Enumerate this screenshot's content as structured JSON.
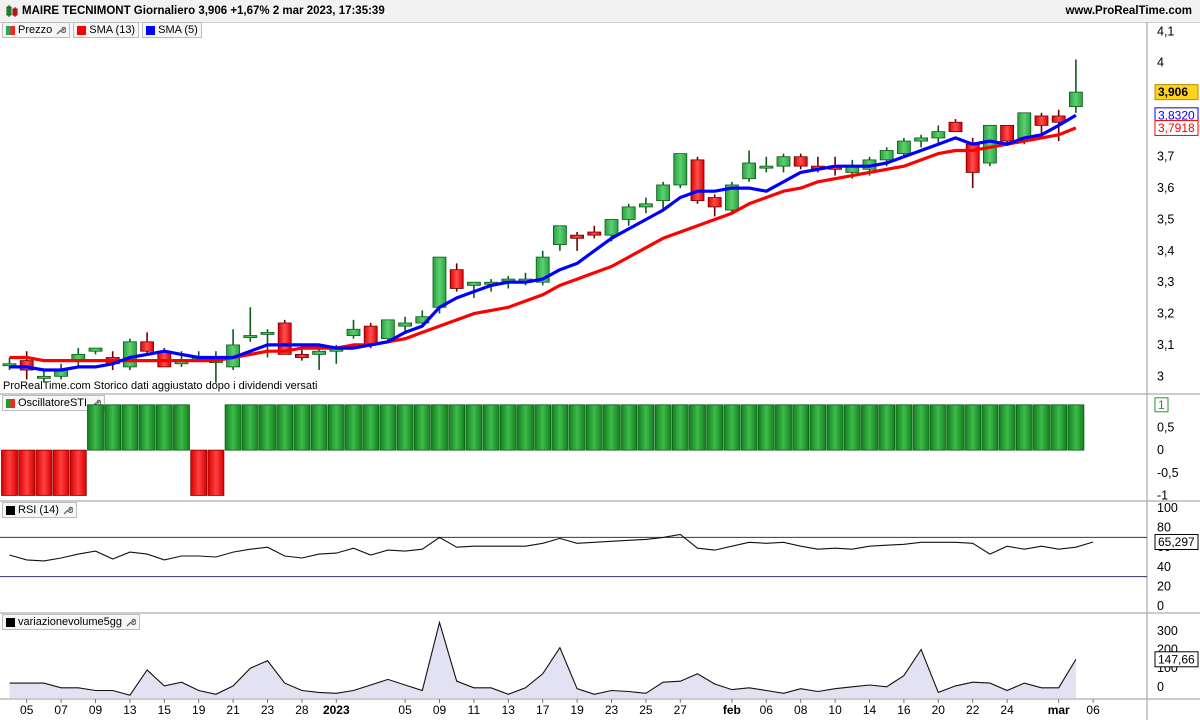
{
  "header": {
    "title": "MAIRE TECNIMONT Giornaliero 3,906 +1,67% 2 mar 2023, 17:35:39",
    "website": "www.ProRealTime.com"
  },
  "legends": {
    "price": [
      {
        "label": "Prezzo",
        "color": "#2e8b3c",
        "icon": "candle-icon"
      },
      {
        "label": "SMA (13)",
        "color": "#ff0000"
      },
      {
        "label": "SMA (5)",
        "color": "#0000ff"
      }
    ],
    "oscillator": "OscillatoreSTI",
    "rsi": "RSI (14)",
    "volume": "variazionevolume5gg"
  },
  "footnote": "ProRealTime.com  Storico dati aggiustato dopo i dividendi versati",
  "colors": {
    "up": "#2ea84a",
    "down": "#ff2020",
    "sma13": "#ff0000",
    "sma5": "#0000ff",
    "osc_pos": "#1f9a2b",
    "osc_neg": "#ff2020",
    "price_badge": "#ffd21f"
  },
  "price_labels": {
    "last": "3,906",
    "sma5": "3,8320",
    "sma13": "3,7918"
  },
  "rsi_label": "65,297",
  "volume_label": "147,66",
  "x_axis": [
    {
      "i": 1,
      "label": "05"
    },
    {
      "i": 3,
      "label": "07"
    },
    {
      "i": 5,
      "label": "09"
    },
    {
      "i": 7,
      "label": "13"
    },
    {
      "i": 9,
      "label": "15"
    },
    {
      "i": 11,
      "label": "19"
    },
    {
      "i": 13,
      "label": "21"
    },
    {
      "i": 15,
      "label": "23"
    },
    {
      "i": 17,
      "label": "28"
    },
    {
      "i": 19,
      "label": "2023",
      "bold": true
    },
    {
      "i": 23,
      "label": "05"
    },
    {
      "i": 25,
      "label": "09"
    },
    {
      "i": 27,
      "label": "11"
    },
    {
      "i": 29,
      "label": "13"
    },
    {
      "i": 31,
      "label": "17"
    },
    {
      "i": 33,
      "label": "19"
    },
    {
      "i": 35,
      "label": "23"
    },
    {
      "i": 37,
      "label": "25"
    },
    {
      "i": 39,
      "label": "27"
    },
    {
      "i": 42,
      "label": "feb",
      "bold": true
    },
    {
      "i": 44,
      "label": "06"
    },
    {
      "i": 46,
      "label": "08"
    },
    {
      "i": 48,
      "label": "10"
    },
    {
      "i": 50,
      "label": "14"
    },
    {
      "i": 52,
      "label": "16"
    },
    {
      "i": 54,
      "label": "20"
    },
    {
      "i": 56,
      "label": "22"
    },
    {
      "i": 58,
      "label": "24"
    },
    {
      "i": 61,
      "label": "mar",
      "bold": true
    },
    {
      "i": 63,
      "label": "06"
    }
  ],
  "chart_data": [
    {
      "type": "candlestick",
      "title": "MAIRE TECNIMONT Giornaliero",
      "ylim": [
        2.95,
        4.12
      ],
      "y_ticks": [
        "3",
        "3,1",
        "3,2",
        "3,3",
        "3,4",
        "3,5",
        "3,6",
        "3,7",
        "4",
        "4,1"
      ],
      "y_tick_values": [
        3.0,
        3.1,
        3.2,
        3.3,
        3.4,
        3.5,
        3.6,
        3.7,
        4.0,
        4.1
      ],
      "candles": [
        {
          "o": 3.04,
          "h": 3.06,
          "l": 3.02,
          "c": 3.04
        },
        {
          "o": 3.05,
          "h": 3.08,
          "l": 2.99,
          "c": 3.02
        },
        {
          "o": 3.0,
          "h": 3.02,
          "l": 2.98,
          "c": 3.0
        },
        {
          "o": 3.0,
          "h": 3.04,
          "l": 2.99,
          "c": 3.02
        },
        {
          "o": 3.05,
          "h": 3.09,
          "l": 3.03,
          "c": 3.07
        },
        {
          "o": 3.08,
          "h": 3.09,
          "l": 3.07,
          "c": 3.09
        },
        {
          "o": 3.06,
          "h": 3.08,
          "l": 3.02,
          "c": 3.04
        },
        {
          "o": 3.03,
          "h": 3.12,
          "l": 3.02,
          "c": 3.11
        },
        {
          "o": 3.11,
          "h": 3.14,
          "l": 3.07,
          "c": 3.08
        },
        {
          "o": 3.08,
          "h": 3.09,
          "l": 3.03,
          "c": 3.03
        },
        {
          "o": 3.04,
          "h": 3.08,
          "l": 3.03,
          "c": 3.05
        },
        {
          "o": 3.06,
          "h": 3.08,
          "l": 3.05,
          "c": 3.06
        },
        {
          "o": 3.05,
          "h": 3.08,
          "l": 2.98,
          "c": 3.05
        },
        {
          "o": 3.03,
          "h": 3.15,
          "l": 3.02,
          "c": 3.1
        },
        {
          "o": 3.13,
          "h": 3.22,
          "l": 3.11,
          "c": 3.13
        },
        {
          "o": 3.14,
          "h": 3.15,
          "l": 3.06,
          "c": 3.14
        },
        {
          "o": 3.17,
          "h": 3.18,
          "l": 3.07,
          "c": 3.07
        },
        {
          "o": 3.07,
          "h": 3.09,
          "l": 3.05,
          "c": 3.06
        },
        {
          "o": 3.07,
          "h": 3.09,
          "l": 3.02,
          "c": 3.08
        },
        {
          "o": 3.08,
          "h": 3.1,
          "l": 3.04,
          "c": 3.09
        },
        {
          "o": 3.13,
          "h": 3.18,
          "l": 3.12,
          "c": 3.15
        },
        {
          "o": 3.16,
          "h": 3.17,
          "l": 3.09,
          "c": 3.1
        },
        {
          "o": 3.12,
          "h": 3.18,
          "l": 3.11,
          "c": 3.18
        },
        {
          "o": 3.16,
          "h": 3.19,
          "l": 3.14,
          "c": 3.17
        },
        {
          "o": 3.17,
          "h": 3.21,
          "l": 3.16,
          "c": 3.19
        },
        {
          "o": 3.22,
          "h": 3.38,
          "l": 3.2,
          "c": 3.38
        },
        {
          "o": 3.34,
          "h": 3.36,
          "l": 3.27,
          "c": 3.28
        },
        {
          "o": 3.29,
          "h": 3.3,
          "l": 3.25,
          "c": 3.3
        },
        {
          "o": 3.3,
          "h": 3.31,
          "l": 3.27,
          "c": 3.3
        },
        {
          "o": 3.31,
          "h": 3.32,
          "l": 3.28,
          "c": 3.31
        },
        {
          "o": 3.3,
          "h": 3.33,
          "l": 3.29,
          "c": 3.31
        },
        {
          "o": 3.3,
          "h": 3.4,
          "l": 3.29,
          "c": 3.38
        },
        {
          "o": 3.42,
          "h": 3.48,
          "l": 3.4,
          "c": 3.48
        },
        {
          "o": 3.45,
          "h": 3.46,
          "l": 3.4,
          "c": 3.44
        },
        {
          "o": 3.46,
          "h": 3.48,
          "l": 3.44,
          "c": 3.45
        },
        {
          "o": 3.45,
          "h": 3.5,
          "l": 3.43,
          "c": 3.5
        },
        {
          "o": 3.5,
          "h": 3.55,
          "l": 3.48,
          "c": 3.54
        },
        {
          "o": 3.54,
          "h": 3.57,
          "l": 3.52,
          "c": 3.55
        },
        {
          "o": 3.56,
          "h": 3.62,
          "l": 3.53,
          "c": 3.61
        },
        {
          "o": 3.61,
          "h": 3.71,
          "l": 3.6,
          "c": 3.71
        },
        {
          "o": 3.69,
          "h": 3.7,
          "l": 3.55,
          "c": 3.56
        },
        {
          "o": 3.57,
          "h": 3.58,
          "l": 3.51,
          "c": 3.54
        },
        {
          "o": 3.53,
          "h": 3.62,
          "l": 3.52,
          "c": 3.61
        },
        {
          "o": 3.63,
          "h": 3.72,
          "l": 3.62,
          "c": 3.68
        },
        {
          "o": 3.67,
          "h": 3.7,
          "l": 3.65,
          "c": 3.67
        },
        {
          "o": 3.67,
          "h": 3.71,
          "l": 3.65,
          "c": 3.7
        },
        {
          "o": 3.7,
          "h": 3.71,
          "l": 3.66,
          "c": 3.67
        },
        {
          "o": 3.67,
          "h": 3.7,
          "l": 3.65,
          "c": 3.66
        },
        {
          "o": 3.67,
          "h": 3.7,
          "l": 3.64,
          "c": 3.66
        },
        {
          "o": 3.65,
          "h": 3.69,
          "l": 3.63,
          "c": 3.67
        },
        {
          "o": 3.66,
          "h": 3.7,
          "l": 3.64,
          "c": 3.69
        },
        {
          "o": 3.69,
          "h": 3.73,
          "l": 3.67,
          "c": 3.72
        },
        {
          "o": 3.71,
          "h": 3.76,
          "l": 3.7,
          "c": 3.75
        },
        {
          "o": 3.75,
          "h": 3.77,
          "l": 3.73,
          "c": 3.76
        },
        {
          "o": 3.76,
          "h": 3.8,
          "l": 3.74,
          "c": 3.78
        },
        {
          "o": 3.81,
          "h": 3.82,
          "l": 3.78,
          "c": 3.78
        },
        {
          "o": 3.74,
          "h": 3.76,
          "l": 3.6,
          "c": 3.65
        },
        {
          "o": 3.68,
          "h": 3.8,
          "l": 3.67,
          "c": 3.8
        },
        {
          "o": 3.8,
          "h": 3.8,
          "l": 3.74,
          "c": 3.75
        },
        {
          "o": 3.76,
          "h": 3.84,
          "l": 3.74,
          "c": 3.84
        },
        {
          "o": 3.83,
          "h": 3.84,
          "l": 3.77,
          "c": 3.8
        },
        {
          "o": 3.83,
          "h": 3.85,
          "l": 3.75,
          "c": 3.81
        },
        {
          "o": 3.86,
          "h": 4.01,
          "l": 3.84,
          "c": 3.906
        }
      ],
      "sma5": [
        3.03,
        3.03,
        3.02,
        3.02,
        3.03,
        3.03,
        3.04,
        3.06,
        3.07,
        3.08,
        3.07,
        3.06,
        3.06,
        3.06,
        3.08,
        3.1,
        3.1,
        3.1,
        3.1,
        3.09,
        3.09,
        3.1,
        3.11,
        3.14,
        3.16,
        3.22,
        3.25,
        3.27,
        3.29,
        3.3,
        3.3,
        3.31,
        3.34,
        3.36,
        3.4,
        3.44,
        3.47,
        3.5,
        3.53,
        3.57,
        3.59,
        3.59,
        3.6,
        3.6,
        3.59,
        3.62,
        3.65,
        3.66,
        3.67,
        3.67,
        3.67,
        3.68,
        3.7,
        3.72,
        3.74,
        3.76,
        3.74,
        3.75,
        3.74,
        3.76,
        3.77,
        3.8,
        3.832
      ],
      "sma13": [
        3.06,
        3.06,
        3.05,
        3.05,
        3.05,
        3.05,
        3.05,
        3.05,
        3.05,
        3.05,
        3.05,
        3.05,
        3.05,
        3.06,
        3.07,
        3.08,
        3.08,
        3.09,
        3.09,
        3.09,
        3.1,
        3.1,
        3.11,
        3.12,
        3.14,
        3.16,
        3.18,
        3.2,
        3.21,
        3.22,
        3.24,
        3.26,
        3.29,
        3.31,
        3.33,
        3.35,
        3.38,
        3.41,
        3.44,
        3.46,
        3.48,
        3.5,
        3.52,
        3.55,
        3.57,
        3.59,
        3.6,
        3.62,
        3.63,
        3.64,
        3.65,
        3.66,
        3.67,
        3.69,
        3.71,
        3.72,
        3.72,
        3.73,
        3.74,
        3.75,
        3.76,
        3.77,
        3.7918
      ]
    },
    {
      "type": "bar",
      "title": "OscillatoreSTI",
      "ylim": [
        -1.1,
        1.15
      ],
      "y_ticks": [
        "1",
        "0,5",
        "0",
        "-0,5",
        "-1"
      ],
      "y_tick_values": [
        1,
        0.5,
        0,
        -0.5,
        -1
      ],
      "values": [
        -1,
        -1,
        -1,
        -1,
        -1,
        1,
        1,
        1,
        1,
        1,
        1,
        -1,
        -1,
        1,
        1,
        1,
        1,
        1,
        1,
        1,
        1,
        1,
        1,
        1,
        1,
        1,
        1,
        1,
        1,
        1,
        1,
        1,
        1,
        1,
        1,
        1,
        1,
        1,
        1,
        1,
        1,
        1,
        1,
        1,
        1,
        1,
        1,
        1,
        1,
        1,
        1,
        1,
        1,
        1,
        1,
        1,
        1,
        1,
        1,
        1,
        1,
        1,
        1
      ]
    },
    {
      "type": "line",
      "title": "RSI (14)",
      "ylim": [
        0,
        100
      ],
      "y_ticks": [
        "100",
        "80",
        "60",
        "40",
        "20",
        "0"
      ],
      "y_tick_values": [
        100,
        80,
        60,
        40,
        20,
        0
      ],
      "levels": [
        70,
        30
      ],
      "values": [
        52,
        47,
        46,
        49,
        53,
        56,
        48,
        55,
        53,
        47,
        51,
        51,
        50,
        55,
        58,
        60,
        51,
        49,
        53,
        54,
        59,
        52,
        57,
        56,
        58,
        70,
        60,
        61,
        61,
        61,
        61,
        64,
        69,
        64,
        65,
        66,
        67,
        68,
        70,
        73,
        59,
        57,
        61,
        65,
        64,
        65,
        61,
        58,
        59,
        58,
        61,
        62,
        63,
        65,
        65,
        65,
        64,
        53,
        61,
        58,
        61,
        58,
        60,
        65.297
      ]
    },
    {
      "type": "area",
      "title": "variazionevolume5gg",
      "ylim": [
        -60,
        380
      ],
      "y_ticks": [
        "300",
        "200",
        "100",
        "0"
      ],
      "y_tick_values": [
        300,
        200,
        100,
        0
      ],
      "values": [
        20,
        20,
        20,
        -5,
        -5,
        -20,
        -20,
        -45,
        90,
        5,
        25,
        -20,
        -40,
        5,
        100,
        140,
        20,
        -20,
        -30,
        -35,
        -20,
        10,
        40,
        10,
        -20,
        345,
        30,
        -5,
        -5,
        -40,
        -5,
        70,
        210,
        -10,
        -40,
        -20,
        -25,
        -35,
        25,
        30,
        70,
        15,
        -15,
        -5,
        -20,
        -35,
        -10,
        -25,
        -10,
        0,
        10,
        0,
        60,
        200,
        -30,
        5,
        25,
        20,
        -20,
        20,
        -5,
        -5,
        147.66
      ]
    }
  ]
}
